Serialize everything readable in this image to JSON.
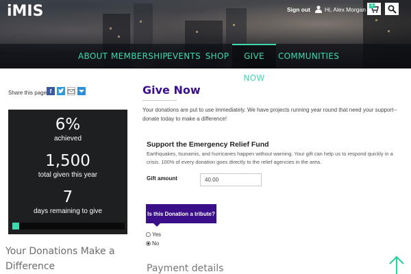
{
  "header": {
    "logo": "iMIS",
    "sign_out": "Sign out",
    "user_greeting": "Hi, Alex Morgan",
    "cart_count": "1",
    "icons": {
      "user": "user-icon",
      "cart": "cart-icon",
      "search": "search-icon"
    }
  },
  "nav": {
    "items": [
      {
        "label": "ABOUT"
      },
      {
        "label": "MEMBERSHIP"
      },
      {
        "label": "EVENTS"
      },
      {
        "label": "SHOP"
      },
      {
        "label": "GIVE NOW",
        "active": true
      },
      {
        "label": "COMMUNITIES"
      }
    ]
  },
  "sidebar": {
    "share_label": "Share this page",
    "share_icons": [
      "facebook-icon",
      "twitter-icon",
      "email-icon",
      "more-icon"
    ],
    "stats": {
      "achieved_value": "6%",
      "achieved_label": "achieved",
      "total_value": "1,500",
      "total_label": "total given this year",
      "days_value": "7",
      "days_label": "days remaining to give",
      "progress_fraction": 0.06
    },
    "heading": "Your Donations Make a Difference"
  },
  "main": {
    "title": "Give Now",
    "intro": "Your donations are put to use immediately. We have projects running year round that need your support--donate today to make a difference!",
    "fund": {
      "title": "Support the Emergency Relief Fund",
      "description": "Earthquakes, tsunamis, and hurricanes happen without warning. Your gift can help us to respond quickly in a crisis. 100% of every donation goes directly to the relief agencies in the area."
    },
    "gift_amount": {
      "label": "Gift amount",
      "value": "40.00"
    },
    "tribute": {
      "button_label": "Is this Donation a tribute?",
      "options": [
        {
          "label": "Yes",
          "checked": false
        },
        {
          "label": "No",
          "checked": true
        }
      ]
    },
    "payment_heading": "Payment details"
  },
  "colors": {
    "accent_teal": "#3fd9b0",
    "brand_purple": "#3b0f8a",
    "stats_panel": "#1e1f21"
  }
}
